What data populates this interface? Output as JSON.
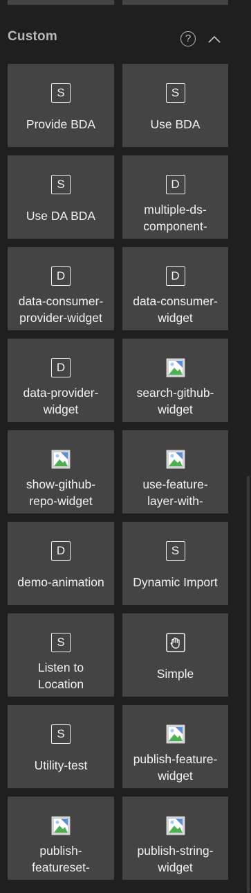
{
  "section": {
    "title": "Custom",
    "help_icon": "?",
    "collapse_icon": "chevron-up-icon"
  },
  "widgets": [
    {
      "icon": "S",
      "icon_type": "letter",
      "label": "Provide BDA"
    },
    {
      "icon": "S",
      "icon_type": "letter",
      "label": "Use BDA"
    },
    {
      "icon": "S",
      "icon_type": "letter",
      "label": "Use DA BDA"
    },
    {
      "icon": "D",
      "icon_type": "letter",
      "label": "multiple-ds-\ncomponent-"
    },
    {
      "icon": "D",
      "icon_type": "letter",
      "label": "data-consumer-\nprovider-widget"
    },
    {
      "icon": "D",
      "icon_type": "letter",
      "label": "data-consumer-\nwidget"
    },
    {
      "icon": "D",
      "icon_type": "letter",
      "label": "data-provider-\nwidget"
    },
    {
      "icon": "image-icon",
      "icon_type": "image",
      "label": "search-github-\nwidget"
    },
    {
      "icon": "image-icon",
      "icon_type": "image",
      "label": "show-github-\nrepo-widget"
    },
    {
      "icon": "image-icon",
      "icon_type": "image",
      "label": "use-feature-\nlayer-with-"
    },
    {
      "icon": "D",
      "icon_type": "letter",
      "label": "demo-animation"
    },
    {
      "icon": "S",
      "icon_type": "letter",
      "label": "Dynamic Import"
    },
    {
      "icon": "S",
      "icon_type": "letter",
      "label": "Listen to\nLocation"
    },
    {
      "icon": "hand-icon",
      "icon_type": "hand",
      "label": "Simple"
    },
    {
      "icon": "S",
      "icon_type": "letter",
      "label": "Utility-test"
    },
    {
      "icon": "image-icon",
      "icon_type": "image",
      "label": "publish-feature-\nwidget"
    },
    {
      "icon": "image-icon",
      "icon_type": "image",
      "label": "publish-\nfeatureset-"
    },
    {
      "icon": "image-icon",
      "icon_type": "image",
      "label": "publish-string-\nwidget"
    }
  ],
  "colors": {
    "background": "#1f1f1f",
    "tile": "#444444",
    "text": "#f1f1f1",
    "header_text": "#b8b8b8"
  }
}
